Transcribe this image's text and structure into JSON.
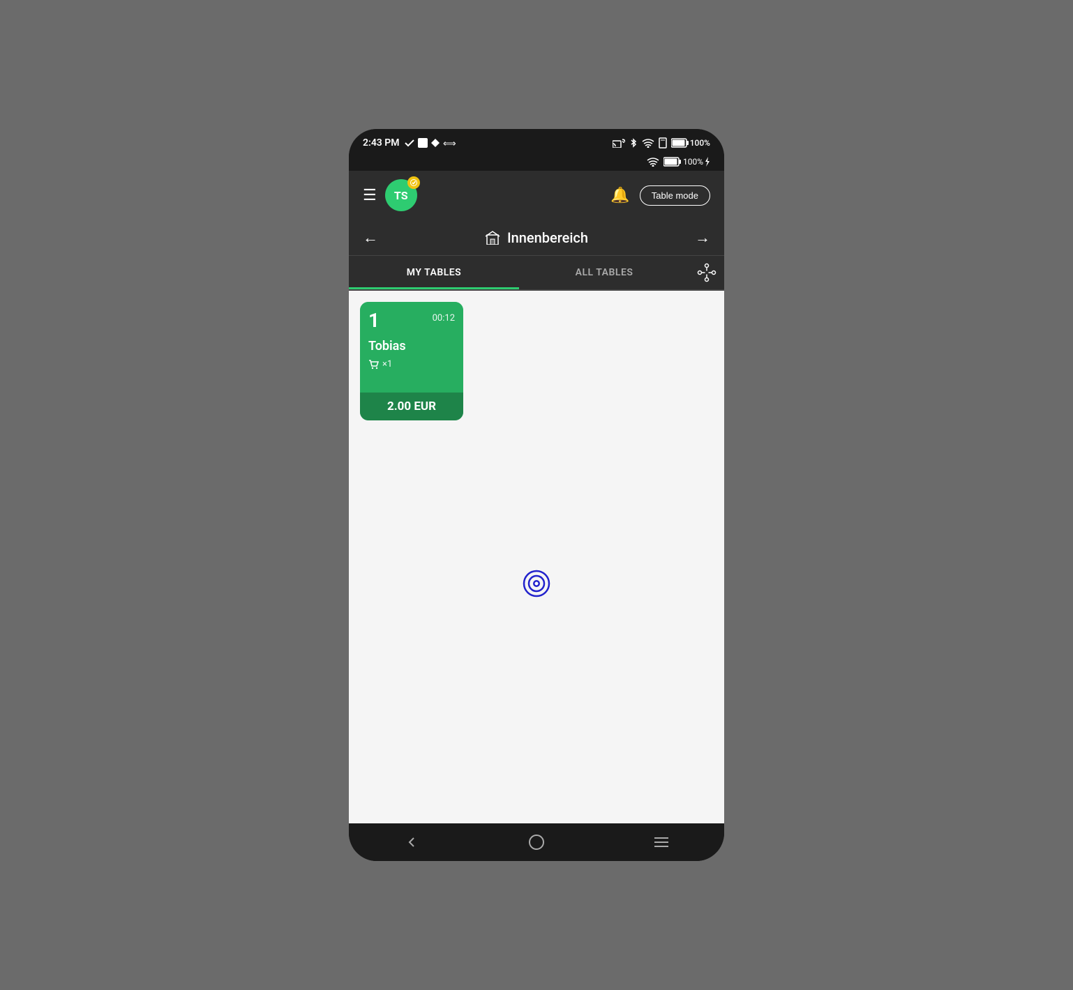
{
  "status": {
    "time": "2:43 PM",
    "battery_percent": "100%",
    "battery_percent2": "100%"
  },
  "header": {
    "avatar_initials": "TS",
    "table_mode_label": "Table mode"
  },
  "navigation": {
    "title": "Innenbereich",
    "back_arrow": "←",
    "forward_arrow": "→"
  },
  "tabs": {
    "my_tables": "MY TABLES",
    "all_tables": "ALL TABLES",
    "active_tab": "my_tables"
  },
  "table_card": {
    "number": "1",
    "time": "00:12",
    "customer_name": "Tobias",
    "order_count": "×1",
    "price": "2.00 EUR"
  },
  "bottom_nav": {
    "back": "‹",
    "home": "○",
    "menu": "≡"
  }
}
